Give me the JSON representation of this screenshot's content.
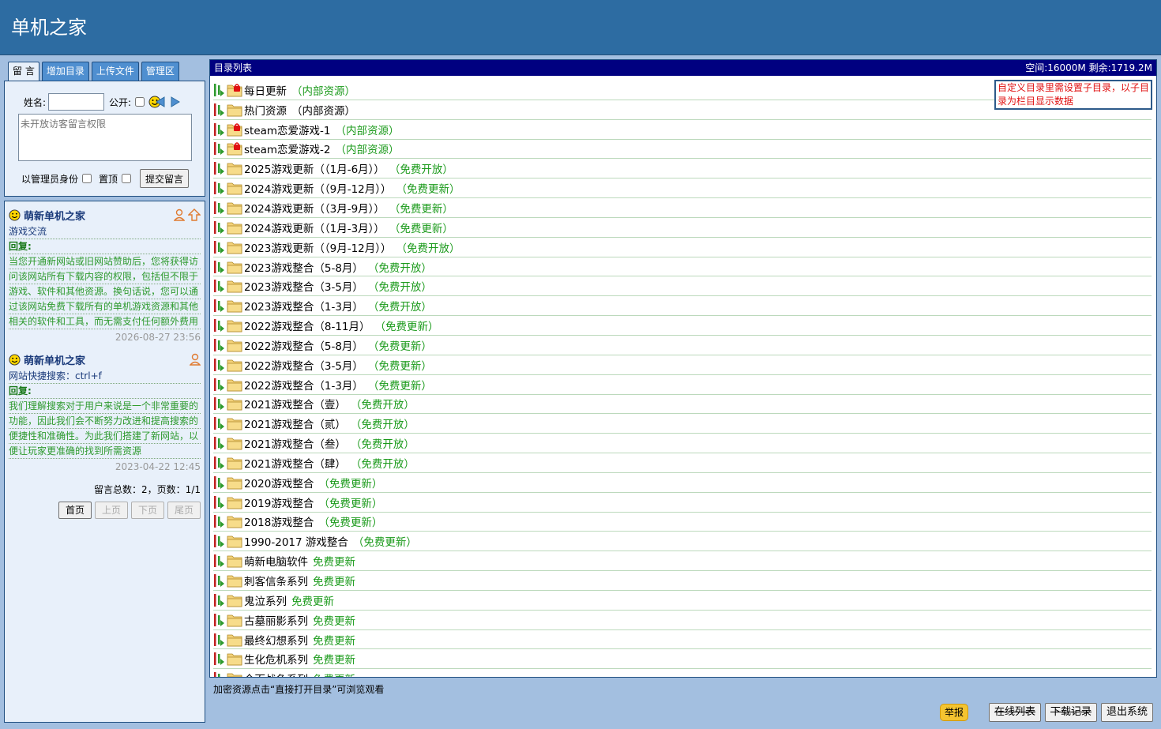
{
  "header": {
    "site_title": "单机之家"
  },
  "left": {
    "tabs": [
      {
        "label": "留 言",
        "active": true
      },
      {
        "label": "增加目录",
        "active": false
      },
      {
        "label": "上传文件",
        "active": false
      },
      {
        "label": "管理区",
        "active": false
      }
    ],
    "form": {
      "name_label": "姓名:",
      "name_value": "",
      "public_label": "公开:",
      "textarea_placeholder": "未开放访客留言权限",
      "admin_label": "以管理员身份",
      "pin_label": "置顶",
      "submit_label": "提交留言"
    },
    "messages": [
      {
        "author": "萌新单机之家",
        "subject": "游戏交流",
        "reply_label": "回复:",
        "reply_lines": [
          "当您开通新网站或旧网站赞助后，您将获得访",
          "问该网站所有下载内容的权限，包括但不限于",
          "游戏、软件和其他资源。换句话说，您可以通",
          "过该网站免费下载所有的单机游戏资源和其他",
          "相关的软件和工具，而无需支付任何额外费用"
        ],
        "time": "2026-08-27 23:56",
        "pinned": true
      },
      {
        "author": "萌新单机之家",
        "subject": "网站快捷搜索：ctrl+f",
        "reply_label": "回复:",
        "reply_lines": [
          "我们理解搜索对于用户来说是一个非常重要的",
          "功能，因此我们会不断努力改进和提高搜索的",
          "便捷性和准确性。为此我们搭建了新网站，以",
          "便让玩家更准确的找到所需资源"
        ],
        "time": "2023-04-22 12:45",
        "pinned": false
      }
    ],
    "stats": "留言总数：2，页数：1/1",
    "pager": {
      "first": "首页",
      "prev": "上页",
      "next": "下页",
      "last": "尾页"
    }
  },
  "directory": {
    "title": "目录列表",
    "space_info": "空间:16000M 剩余:1719.2M",
    "tip": "自定义目录里需设置子目录，以子目录为栏目显示数据",
    "rows": [
      {
        "name": "每日更新",
        "tag": "（内部资源）",
        "locked": true,
        "tag_color": "#1a9a1a"
      },
      {
        "name": "热门资源",
        "tag": "（内部资源）",
        "locked": false,
        "tag_color": "#000000"
      },
      {
        "name": "steam恋爱游戏-1",
        "tag": "（内部资源）",
        "locked": true,
        "tag_color": "#1a9a1a"
      },
      {
        "name": "steam恋爱游戏-2",
        "tag": "（内部资源）",
        "locked": true,
        "tag_color": "#1a9a1a"
      },
      {
        "name": "2025游戏更新（（1月-6月））",
        "tag": "（免费开放）",
        "locked": false,
        "tag_color": "#1a9a1a"
      },
      {
        "name": "2024游戏更新（（9月-12月））",
        "tag": "（免费更新）",
        "locked": false,
        "tag_color": "#1a9a1a"
      },
      {
        "name": "2024游戏更新（（3月-9月））",
        "tag": "（免费更新）",
        "locked": false,
        "tag_color": "#1a9a1a"
      },
      {
        "name": "2024游戏更新（（1月-3月））",
        "tag": "（免费更新）",
        "locked": false,
        "tag_color": "#1a9a1a"
      },
      {
        "name": "2023游戏更新（（9月-12月））",
        "tag": "（免费开放）",
        "locked": false,
        "tag_color": "#1a9a1a"
      },
      {
        "name": "2023游戏整合（5-8月）",
        "tag": "（免费开放）",
        "locked": false,
        "tag_color": "#1a9a1a"
      },
      {
        "name": "2023游戏整合（3-5月）",
        "tag": "（免费开放）",
        "locked": false,
        "tag_color": "#1a9a1a"
      },
      {
        "name": "2023游戏整合（1-3月）",
        "tag": "（免费开放）",
        "locked": false,
        "tag_color": "#1a9a1a"
      },
      {
        "name": "2022游戏整合（8-11月）",
        "tag": "（免费更新）",
        "locked": false,
        "tag_color": "#1a9a1a"
      },
      {
        "name": "2022游戏整合（5-8月）",
        "tag": "（免费更新）",
        "locked": false,
        "tag_color": "#1a9a1a"
      },
      {
        "name": "2022游戏整合（3-5月）",
        "tag": "（免费更新）",
        "locked": false,
        "tag_color": "#1a9a1a"
      },
      {
        "name": "2022游戏整合（1-3月）",
        "tag": "（免费更新）",
        "locked": false,
        "tag_color": "#1a9a1a"
      },
      {
        "name": "2021游戏整合（壹）",
        "tag": "（免费开放）",
        "locked": false,
        "tag_color": "#1a9a1a"
      },
      {
        "name": "2021游戏整合（贰）",
        "tag": "（免费开放）",
        "locked": false,
        "tag_color": "#1a9a1a"
      },
      {
        "name": "2021游戏整合（叁）",
        "tag": "（免费开放）",
        "locked": false,
        "tag_color": "#1a9a1a"
      },
      {
        "name": "2021游戏整合（肆）",
        "tag": "（免费开放）",
        "locked": false,
        "tag_color": "#1a9a1a"
      },
      {
        "name": "2020游戏整合",
        "tag": "（免费更新）",
        "locked": false,
        "tag_color": "#1a9a1a"
      },
      {
        "name": "2019游戏整合",
        "tag": "（免费更新）",
        "locked": false,
        "tag_color": "#1a9a1a"
      },
      {
        "name": "2018游戏整合",
        "tag": "（免费更新）",
        "locked": false,
        "tag_color": "#1a9a1a"
      },
      {
        "name": "1990-2017 游戏整合",
        "tag": "（免费更新）",
        "locked": false,
        "tag_color": "#1a9a1a"
      },
      {
        "name": "萌新电脑软件",
        "tag": "免费更新",
        "locked": false,
        "tag_color": "#1a9a1a"
      },
      {
        "name": "刺客信条系列",
        "tag": "免费更新",
        "locked": false,
        "tag_color": "#1a9a1a"
      },
      {
        "name": "鬼泣系列",
        "tag": "免费更新",
        "locked": false,
        "tag_color": "#1a9a1a"
      },
      {
        "name": "古墓丽影系列",
        "tag": "免费更新",
        "locked": false,
        "tag_color": "#1a9a1a"
      },
      {
        "name": "最终幻想系列",
        "tag": "免费更新",
        "locked": false,
        "tag_color": "#1a9a1a"
      },
      {
        "name": "生化危机系列",
        "tag": "免费更新",
        "locked": false,
        "tag_color": "#1a9a1a"
      },
      {
        "name": "全面战争系列",
        "tag": "免费更新",
        "locked": false,
        "tag_color": "#1a9a1a"
      }
    ]
  },
  "footer": {
    "note": "加密资源点击“直接打开目录”可浏览观看",
    "report": "举报",
    "online_list": "在线列表",
    "download_log": "下载记录",
    "logout": "退出系统"
  },
  "colors": {
    "header_bg": "#2d6ca2",
    "page_bg": "#a3bfe0",
    "list_header_bg": "#000080",
    "tag_green": "#1a9a1a"
  }
}
